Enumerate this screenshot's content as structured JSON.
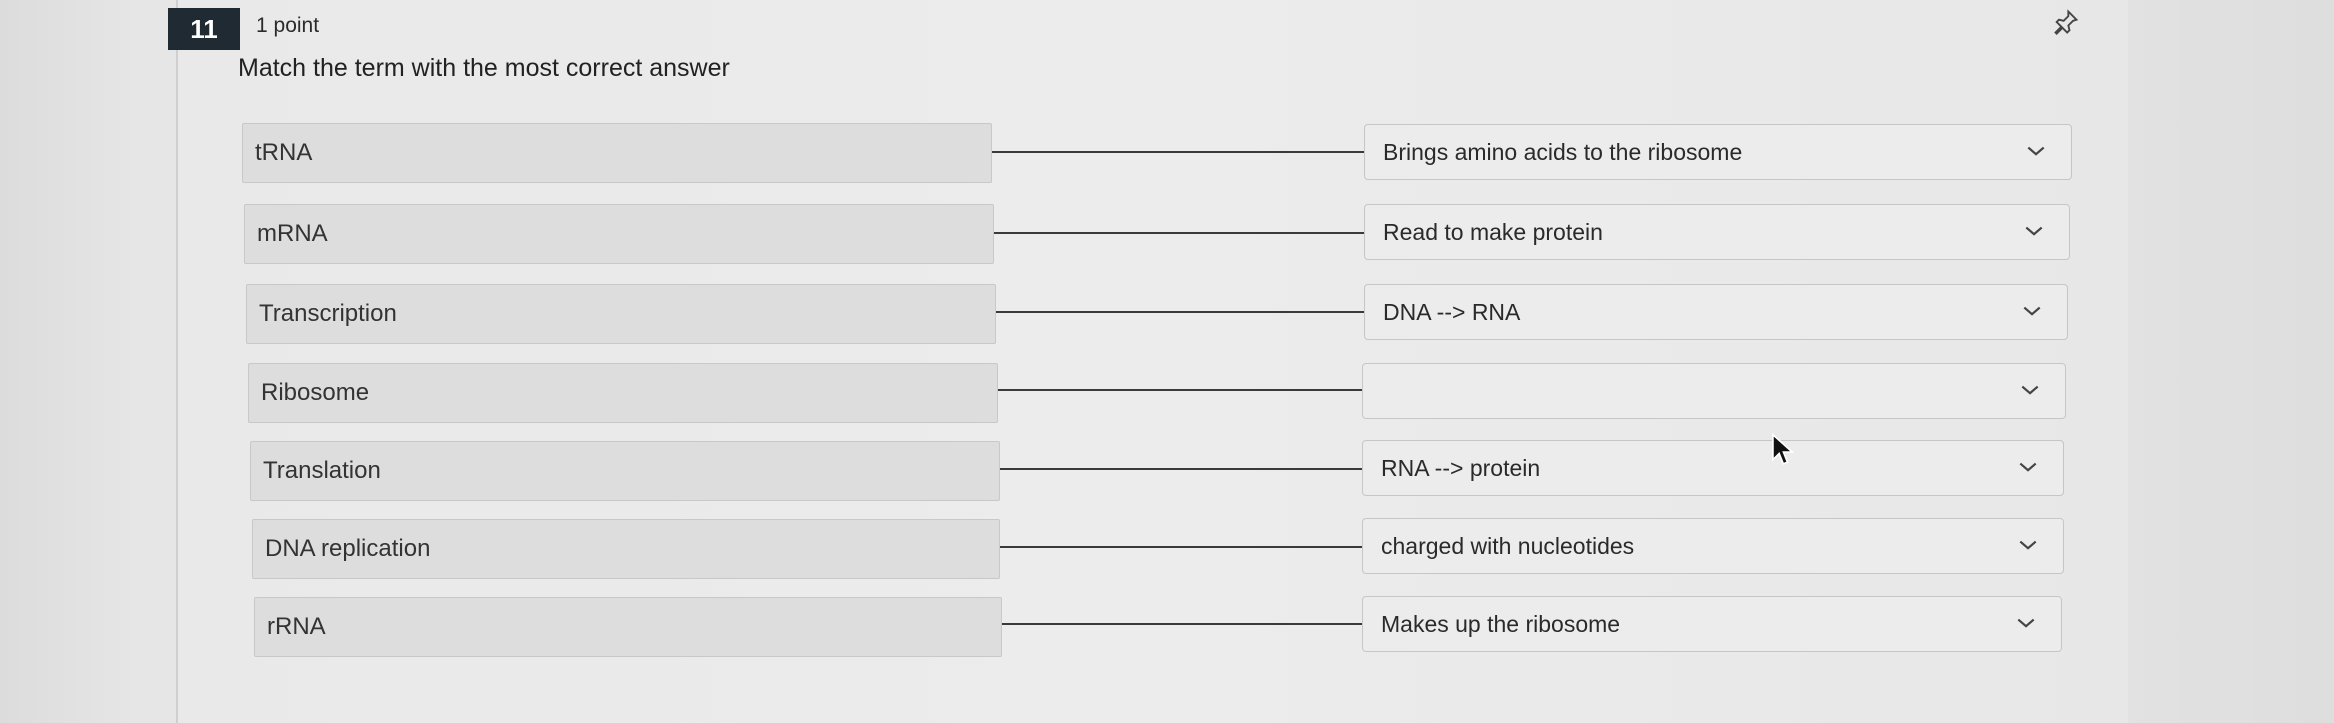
{
  "question": {
    "number": "11",
    "points": "1 point",
    "prompt": "Match the term with the most correct answer"
  },
  "rows": [
    {
      "term": "tRNA",
      "answer": "Brings amino acids to the ribosome"
    },
    {
      "term": "mRNA",
      "answer": "Read to make protein"
    },
    {
      "term": "Transcription",
      "answer": "DNA --> RNA"
    },
    {
      "term": "Ribosome",
      "answer": ""
    },
    {
      "term": "Translation",
      "answer": "RNA --> protein"
    },
    {
      "term": "DNA replication",
      "answer": "charged with nucleotides"
    },
    {
      "term": "rRNA",
      "answer": "Makes up the ribosome"
    }
  ],
  "icons": {
    "pin": "pin-icon",
    "dropdown": "chevron-down-icon",
    "cursor": "mouse-pointer-icon"
  }
}
